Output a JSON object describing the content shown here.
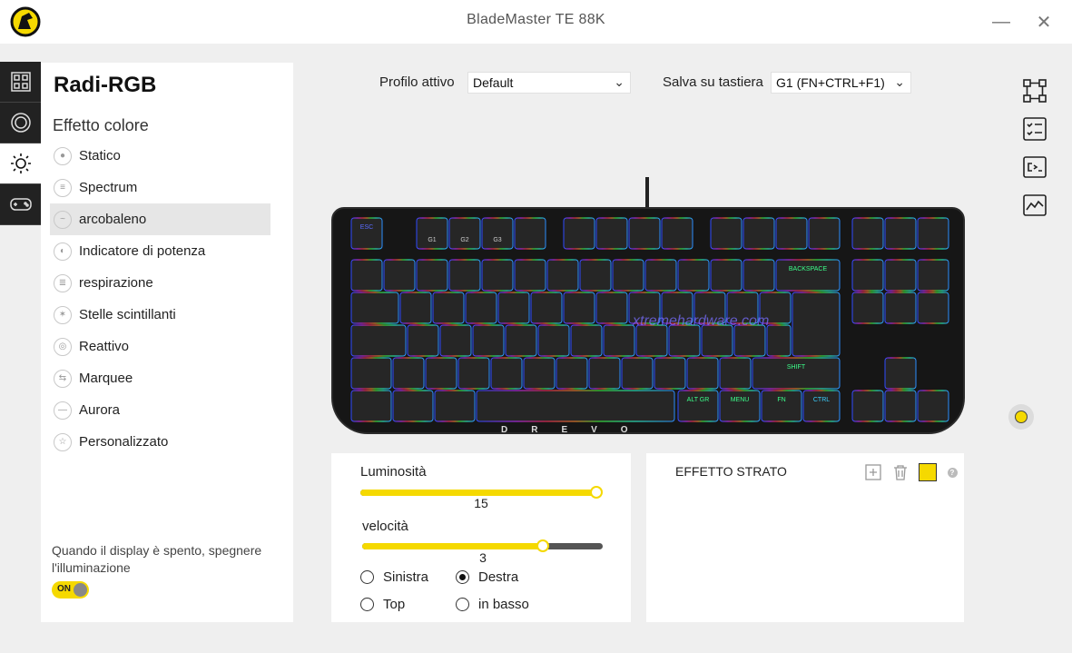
{
  "app": {
    "title": "BladeMaster TE 88K"
  },
  "window": {
    "minimize": "—",
    "close": "✕"
  },
  "left_rail": [
    {
      "icon": "keys-grid-icon"
    },
    {
      "icon": "dial-icon"
    },
    {
      "icon": "sun-lighting-icon",
      "active": true
    },
    {
      "icon": "gamepad-icon"
    }
  ],
  "panel": {
    "title": "Radi-RGB",
    "section": "Effetto colore",
    "effects": [
      {
        "label": "Statico"
      },
      {
        "label": "Spectrum"
      },
      {
        "label": "arcobaleno",
        "active": true
      },
      {
        "label": "Indicatore di potenza"
      },
      {
        "label": "respirazione"
      },
      {
        "label": "Stelle scintillanti"
      },
      {
        "label": "Reattivo"
      },
      {
        "label": "Marquee"
      },
      {
        "label": "Aurora"
      },
      {
        "label": "Personalizzato"
      }
    ],
    "display_note": "Quando il display è spento, spegnere l'illuminazione",
    "toggle_label": "ON"
  },
  "top": {
    "profile_label": "Profilo attivo",
    "profile_value": "Default",
    "save_label": "Salva su tastiera",
    "save_value": "G1 (FN+CTRL+F1)"
  },
  "right_rail": [
    "layout-icon",
    "checklist-icon",
    "terminal-icon",
    "monitor-chart-icon"
  ],
  "keyboard": {
    "brand": "DREVO",
    "watermark": "xtremehardware.com",
    "keys": {
      "esc": "ESC",
      "g1": "G1",
      "g2": "G2",
      "g3": "G3",
      "backspace": "BACKSPACE",
      "shift": "SHIFT",
      "altgr": "ALT GR",
      "menu": "MENU",
      "fn": "FN",
      "ctrl": "CTRL"
    }
  },
  "brightness": {
    "label": "Luminosità",
    "value": "15",
    "fraction": 1.0
  },
  "speed": {
    "label": "velocità",
    "value": "3",
    "fraction": 0.75
  },
  "direction": [
    {
      "label": "Sinistra",
      "checked": false
    },
    {
      "label": "Destra",
      "checked": true
    },
    {
      "label": "Top",
      "checked": false
    },
    {
      "label": "in basso",
      "checked": false
    }
  ],
  "layer": {
    "title": "EFFETTO STRATO",
    "color": "#f5d900",
    "help": "?"
  },
  "colors": {
    "accent": "#f5d900",
    "rail_dark": "#222222"
  }
}
